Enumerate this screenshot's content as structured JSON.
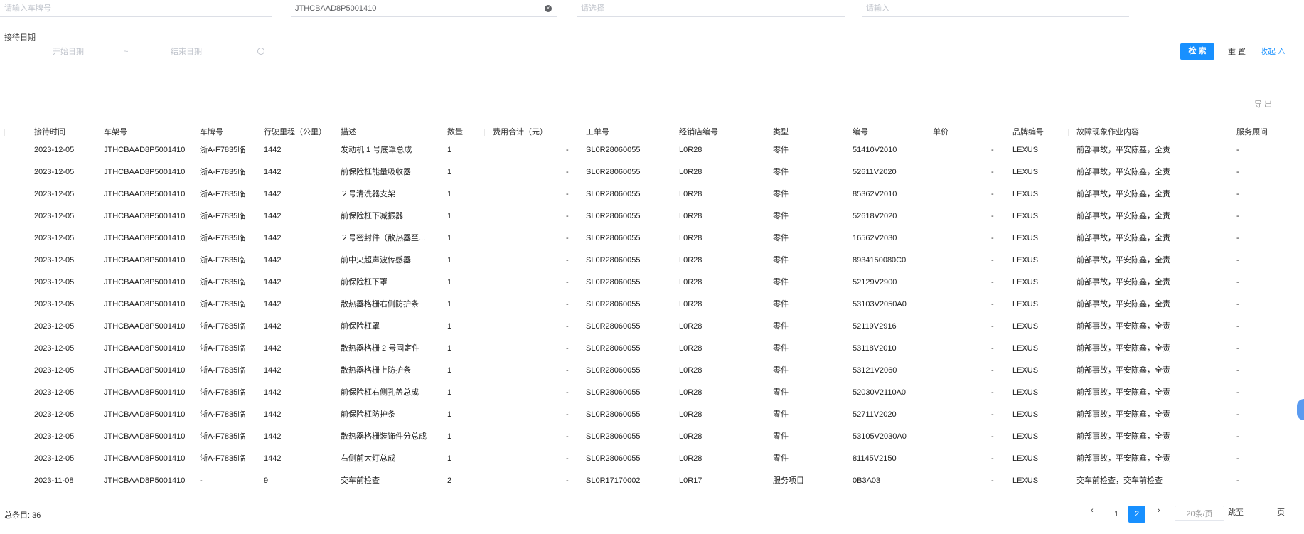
{
  "filters": {
    "plate_placeholder": "请输入车牌号",
    "vin_value": "JTHCBAAD8P5001410",
    "select_placeholder": "请选择",
    "input_placeholder": "请输入",
    "date_label": "接待日期",
    "start_placeholder": "开始日期",
    "date_sep": "~",
    "end_placeholder": "结束日期"
  },
  "actions": {
    "search": "检 索",
    "reset": "重 置",
    "collapse": "收起 ∧",
    "export": "导 出"
  },
  "table": {
    "headers": [
      "接待时间",
      "车架号",
      "车牌号",
      "行驶里程（公里）",
      "描述",
      "数量",
      "费用合计（元）",
      "工单号",
      "经销店编号",
      "类型",
      "编号",
      "单价",
      "品牌编号",
      "故障现象作业内容",
      "服务顾问"
    ],
    "rows": [
      [
        "2023-12-05",
        "JTHCBAAD8P5001410",
        "浙A-F7835临",
        "1442",
        "发动机 1 号底罩总成",
        "1",
        "-",
        "SL0R28060055",
        "L0R28",
        "零件",
        "51410V2010",
        "-",
        "LEXUS",
        "前部事故，平安陈鑫，全责",
        "-"
      ],
      [
        "2023-12-05",
        "JTHCBAAD8P5001410",
        "浙A-F7835临",
        "1442",
        "前保险杠能量吸收器",
        "1",
        "-",
        "SL0R28060055",
        "L0R28",
        "零件",
        "52611V2020",
        "-",
        "LEXUS",
        "前部事故，平安陈鑫，全责",
        "-"
      ],
      [
        "2023-12-05",
        "JTHCBAAD8P5001410",
        "浙A-F7835临",
        "1442",
        "２号清洗器支架",
        "1",
        "-",
        "SL0R28060055",
        "L0R28",
        "零件",
        "85362V2010",
        "-",
        "LEXUS",
        "前部事故，平安陈鑫，全责",
        "-"
      ],
      [
        "2023-12-05",
        "JTHCBAAD8P5001410",
        "浙A-F7835临",
        "1442",
        "前保险杠下减振器",
        "1",
        "-",
        "SL0R28060055",
        "L0R28",
        "零件",
        "52618V2020",
        "-",
        "LEXUS",
        "前部事故，平安陈鑫，全责",
        "-"
      ],
      [
        "2023-12-05",
        "JTHCBAAD8P5001410",
        "浙A-F7835临",
        "1442",
        "２号密封件（散热器至...",
        "1",
        "-",
        "SL0R28060055",
        "L0R28",
        "零件",
        "16562V2030",
        "-",
        "LEXUS",
        "前部事故，平安陈鑫，全责",
        "-"
      ],
      [
        "2023-12-05",
        "JTHCBAAD8P5001410",
        "浙A-F7835临",
        "1442",
        "前中央超声波传感器",
        "1",
        "-",
        "SL0R28060055",
        "L0R28",
        "零件",
        "8934150080C0",
        "-",
        "LEXUS",
        "前部事故，平安陈鑫，全责",
        "-"
      ],
      [
        "2023-12-05",
        "JTHCBAAD8P5001410",
        "浙A-F7835临",
        "1442",
        "前保险杠下罩",
        "1",
        "-",
        "SL0R28060055",
        "L0R28",
        "零件",
        "52129V2900",
        "-",
        "LEXUS",
        "前部事故，平安陈鑫，全责",
        "-"
      ],
      [
        "2023-12-05",
        "JTHCBAAD8P5001410",
        "浙A-F7835临",
        "1442",
        "散热器格栅右侧防护条",
        "1",
        "-",
        "SL0R28060055",
        "L0R28",
        "零件",
        "53103V2050A0",
        "-",
        "LEXUS",
        "前部事故，平安陈鑫，全责",
        "-"
      ],
      [
        "2023-12-05",
        "JTHCBAAD8P5001410",
        "浙A-F7835临",
        "1442",
        "前保险杠罩",
        "1",
        "-",
        "SL0R28060055",
        "L0R28",
        "零件",
        "52119V2916",
        "-",
        "LEXUS",
        "前部事故，平安陈鑫，全责",
        "-"
      ],
      [
        "2023-12-05",
        "JTHCBAAD8P5001410",
        "浙A-F7835临",
        "1442",
        "散热器格栅 2 号固定件",
        "1",
        "-",
        "SL0R28060055",
        "L0R28",
        "零件",
        "53118V2010",
        "-",
        "LEXUS",
        "前部事故，平安陈鑫，全责",
        "-"
      ],
      [
        "2023-12-05",
        "JTHCBAAD8P5001410",
        "浙A-F7835临",
        "1442",
        "散热器格栅上防护条",
        "1",
        "-",
        "SL0R28060055",
        "L0R28",
        "零件",
        "53121V2060",
        "-",
        "LEXUS",
        "前部事故，平安陈鑫，全责",
        "-"
      ],
      [
        "2023-12-05",
        "JTHCBAAD8P5001410",
        "浙A-F7835临",
        "1442",
        "前保险杠右侧孔盖总成",
        "1",
        "-",
        "SL0R28060055",
        "L0R28",
        "零件",
        "52030V2110A0",
        "-",
        "LEXUS",
        "前部事故，平安陈鑫，全责",
        "-"
      ],
      [
        "2023-12-05",
        "JTHCBAAD8P5001410",
        "浙A-F7835临",
        "1442",
        "前保险杠防护条",
        "1",
        "-",
        "SL0R28060055",
        "L0R28",
        "零件",
        "52711V2020",
        "-",
        "LEXUS",
        "前部事故，平安陈鑫，全责",
        "-"
      ],
      [
        "2023-12-05",
        "JTHCBAAD8P5001410",
        "浙A-F7835临",
        "1442",
        "散热器格栅装饰件分总成",
        "1",
        "-",
        "SL0R28060055",
        "L0R28",
        "零件",
        "53105V2030A0",
        "-",
        "LEXUS",
        "前部事故，平安陈鑫，全责",
        "-"
      ],
      [
        "2023-12-05",
        "JTHCBAAD8P5001410",
        "浙A-F7835临",
        "1442",
        "右侧前大灯总成",
        "1",
        "-",
        "SL0R28060055",
        "L0R28",
        "零件",
        "81145V2150",
        "-",
        "LEXUS",
        "前部事故，平安陈鑫，全责",
        "-"
      ],
      [
        "2023-11-08",
        "JTHCBAAD8P5001410",
        "-",
        "9",
        "交车前检查",
        "2",
        "-",
        "SL0R17170002",
        "L0R17",
        "服务项目",
        "0B3A03",
        "-",
        "LEXUS",
        "交车前检查，交车前检查",
        "-"
      ]
    ]
  },
  "footer": {
    "total": "总条目: 36",
    "prev": "‹",
    "page1": "1",
    "page2": "2",
    "next": "›",
    "page_size": "20条/页",
    "goto": "跳至",
    "page_unit": "页"
  }
}
